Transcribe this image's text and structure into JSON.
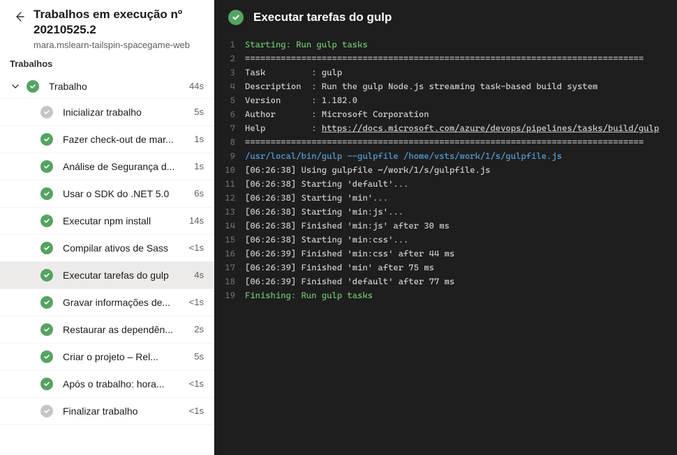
{
  "sidebar": {
    "title": "Trabalhos em execução nº 20210525.2",
    "breadcrumb": "mara.mslearn-tailspin-spacegame-web",
    "section": "Trabalhos",
    "group": {
      "label": "Trabalho",
      "duration": "44s"
    },
    "steps": [
      {
        "label": "Inicializar trabalho",
        "duration": "5s",
        "status": "neutral"
      },
      {
        "label": "Fazer check-out de mar...",
        "duration": "1s",
        "status": "success"
      },
      {
        "label": "Análise de Segurança d...",
        "duration": "1s",
        "status": "success"
      },
      {
        "label": "Usar o SDK do .NET 5.0",
        "duration": "6s",
        "status": "success"
      },
      {
        "label": "Executar npm install",
        "duration": "14s",
        "status": "success"
      },
      {
        "label": "Compilar ativos de Sass",
        "duration": "<1s",
        "status": "success"
      },
      {
        "label": "Executar tarefas do gulp",
        "duration": "4s",
        "status": "success",
        "selected": true
      },
      {
        "label": "Gravar informações de...",
        "duration": "<1s",
        "status": "success"
      },
      {
        "label": "Restaurar as dependên...",
        "duration": "2s",
        "status": "success"
      },
      {
        "label": "Criar o projeto – Rel...",
        "duration": "5s",
        "status": "success"
      },
      {
        "label": "Após o trabalho: hora...",
        "duration": "<1s",
        "status": "success"
      },
      {
        "label": "Finalizar trabalho",
        "duration": "<1s",
        "status": "neutral"
      }
    ]
  },
  "main": {
    "title": "Executar tarefas do gulp"
  },
  "log": [
    {
      "n": 1,
      "kind": "green",
      "text": "Starting: Run gulp tasks"
    },
    {
      "n": 2,
      "kind": "plain",
      "text": "=============================================================================="
    },
    {
      "n": 3,
      "kind": "plain",
      "text": "Task         : gulp"
    },
    {
      "n": 4,
      "kind": "plain",
      "text": "Description  : Run the gulp Node.js streaming task-based build system"
    },
    {
      "n": 5,
      "kind": "plain",
      "text": "Version      : 1.182.0"
    },
    {
      "n": 6,
      "kind": "plain",
      "text": "Author       : Microsoft Corporation"
    },
    {
      "n": 7,
      "kind": "help",
      "prefix": "Help         : ",
      "link": "https://docs.microsoft.com/azure/devops/pipelines/tasks/build/gulp"
    },
    {
      "n": 8,
      "kind": "plain",
      "text": "=============================================================================="
    },
    {
      "n": 9,
      "kind": "blue",
      "text": "/usr/local/bin/gulp --gulpfile /home/vsts/work/1/s/gulpfile.js"
    },
    {
      "n": 10,
      "kind": "plain",
      "text": "[06:26:38] Using gulpfile ~/work/1/s/gulpfile.js"
    },
    {
      "n": 11,
      "kind": "plain",
      "text": "[06:26:38] Starting 'default'..."
    },
    {
      "n": 12,
      "kind": "plain",
      "text": "[06:26:38] Starting 'min'..."
    },
    {
      "n": 13,
      "kind": "plain",
      "text": "[06:26:38] Starting 'min:js'..."
    },
    {
      "n": 14,
      "kind": "plain",
      "text": "[06:26:38] Finished 'min:js' after 30 ms"
    },
    {
      "n": 15,
      "kind": "plain",
      "text": "[06:26:38] Starting 'min:css'..."
    },
    {
      "n": 16,
      "kind": "plain",
      "text": "[06:26:39] Finished 'min:css' after 44 ms"
    },
    {
      "n": 17,
      "kind": "plain",
      "text": "[06:26:39] Finished 'min' after 75 ms"
    },
    {
      "n": 18,
      "kind": "plain",
      "text": "[06:26:39] Finished 'default' after 77 ms"
    },
    {
      "n": 19,
      "kind": "green",
      "text": "Finishing: Run gulp tasks"
    }
  ]
}
